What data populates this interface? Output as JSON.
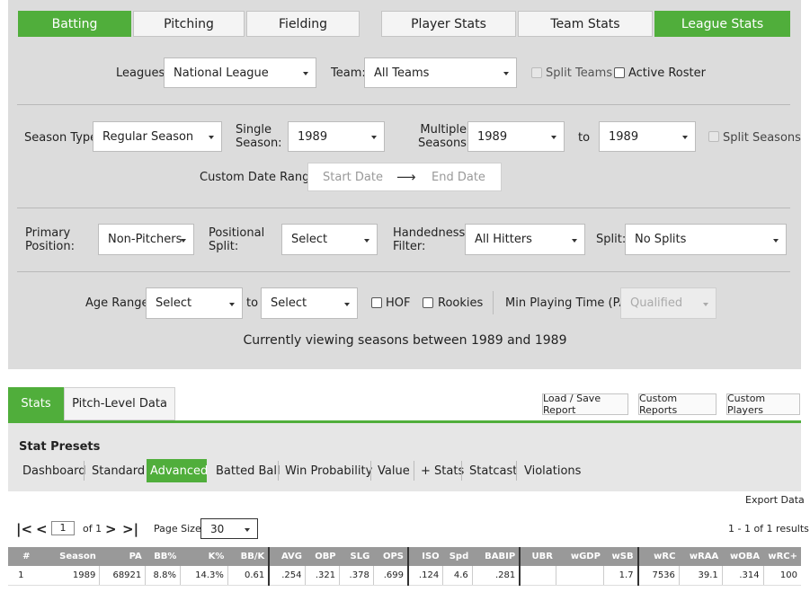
{
  "top_tabs": [
    {
      "label": "Batting",
      "active": true
    },
    {
      "label": "Pitching",
      "active": false
    },
    {
      "label": "Fielding",
      "active": false
    },
    {
      "label": "Player Stats",
      "active": false
    },
    {
      "label": "Team Stats",
      "active": false
    },
    {
      "label": "League Stats",
      "active": true
    }
  ],
  "filters": {
    "leagues_label": "Leagues:",
    "leagues_value": "National League",
    "team_label": "Team:",
    "team_value": "All Teams",
    "split_teams_label": "Split Teams",
    "active_roster_label": "Active Roster",
    "season_type_label": "Season Type:",
    "season_type_value": "Regular Season",
    "single_season_label": "Single Season:",
    "single_season_value": "1989",
    "multiple_seasons_label": "Multiple Seasons:",
    "multi_from": "1989",
    "to_label": "to",
    "multi_to": "1989",
    "split_seasons_label": "Split Seasons",
    "custom_date_label": "Custom Date Range:",
    "start_date_placeholder": "Start Date",
    "end_date_placeholder": "End Date",
    "arrow": "⟶",
    "primary_position_label": "Primary Position:",
    "primary_position_value": "Non-Pitchers",
    "positional_split_label": "Positional Split:",
    "positional_split_value": "Select",
    "handedness_label": "Handedness Filter:",
    "handedness_value": "All Hitters",
    "split_label": "Split:",
    "split_value": "No Splits",
    "age_range_label": "Age Range:",
    "age_from": "Select",
    "age_to_label": "to",
    "age_to": "Select",
    "hof_label": "HOF",
    "rookies_label": "Rookies",
    "min_pt_label": "Min Playing Time (PA):",
    "min_pt_value": "Qualified",
    "viewing_text": "Currently viewing seasons between 1989 and 1989"
  },
  "subtabs": {
    "stats": "Stats",
    "pitch_level": "Pitch-Level Data"
  },
  "buttons": {
    "load_save": "Load / Save Report",
    "custom_reports": "Custom Reports",
    "custom_players": "Custom Players"
  },
  "presets": {
    "title": "Stat Presets",
    "items": [
      "Dashboard",
      "Standard",
      "Advanced",
      "Batted Ball",
      "Win Probability",
      "Value",
      "+ Stats",
      "Statcast",
      "Violations"
    ],
    "active": "Advanced"
  },
  "export_label": "Export Data",
  "pager": {
    "first": "|<",
    "prev": "<",
    "page_value": "1",
    "of_text": "of 1",
    "next": ">",
    "last": ">|",
    "page_size_label": "Page Size:",
    "page_size_value": "30",
    "results_text": "1 - 1 of 1 results"
  },
  "table": {
    "headers": [
      "#",
      "Season",
      "PA",
      "BB%",
      "K%",
      "BB/K",
      "AVG",
      "OBP",
      "SLG",
      "OPS",
      "ISO",
      "Spd",
      "BABIP",
      "UBR",
      "wGDP",
      "wSB",
      "wRC",
      "wRAA",
      "wOBA",
      "wRC+"
    ],
    "rows": [
      [
        "1",
        "1989",
        "68921",
        "8.8%",
        "14.3%",
        "0.61",
        ".254",
        ".321",
        ".378",
        ".699",
        ".124",
        "4.6",
        ".281",
        "",
        "",
        "1.7",
        "7536",
        "39.1",
        ".314",
        "100"
      ]
    ]
  },
  "colors": {
    "accent": "#50ae3b",
    "panel_bg": "#dcdcdc",
    "header_bg": "#999999"
  }
}
